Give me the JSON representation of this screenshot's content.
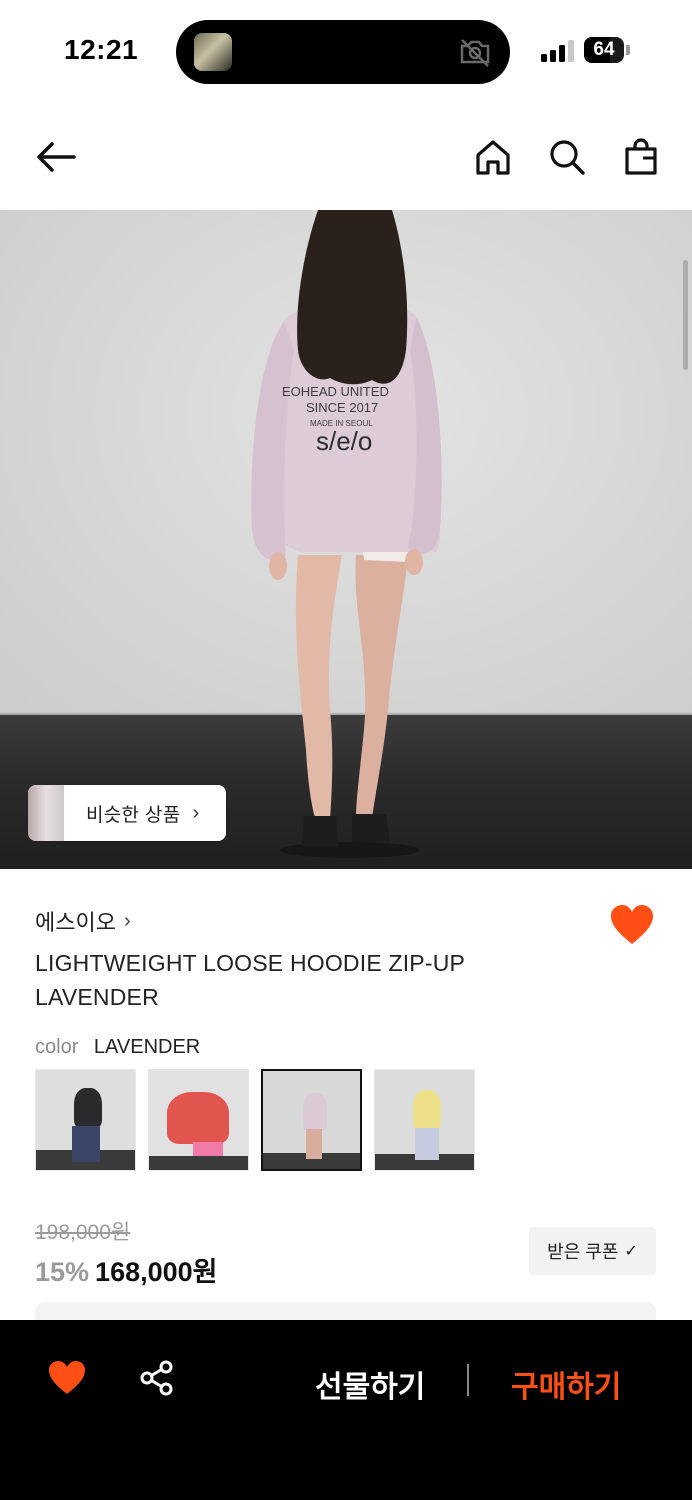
{
  "status_bar": {
    "time": "12:21",
    "battery": "64",
    "battery_level": 0.64
  },
  "header": {
    "back_icon": "arrow-left-icon",
    "home_icon": "home-icon",
    "search_icon": "search-icon",
    "cart_icon": "shopping-bag-icon"
  },
  "hero": {
    "similar_products_label": "비슷한 상품",
    "similar_chevron": "›"
  },
  "product": {
    "brand": "에스이오",
    "brand_chevron": "›",
    "title": "LIGHTWEIGHT LOOSE HOODIE ZIP-UP LAVENDER",
    "color_label": "color",
    "color_value": "LAVENDER",
    "wishlist_icon": "heart-icon",
    "accent_color": "#ff4f14",
    "swatches": [
      {
        "name": "black",
        "selected": false
      },
      {
        "name": "red",
        "selected": false
      },
      {
        "name": "lavender",
        "selected": true
      },
      {
        "name": "yellow",
        "selected": false
      }
    ]
  },
  "price": {
    "original": "198,000원",
    "discount": "15%",
    "current": "168,000원",
    "coupon_label": "받은 쿠폰",
    "coupon_check": "✓"
  },
  "bottom_bar": {
    "gift_label": "선물하기",
    "buy_label": "구매하기",
    "heart_icon": "heart-icon",
    "share_icon": "share-icon",
    "buy_color": "#ff4f14"
  }
}
